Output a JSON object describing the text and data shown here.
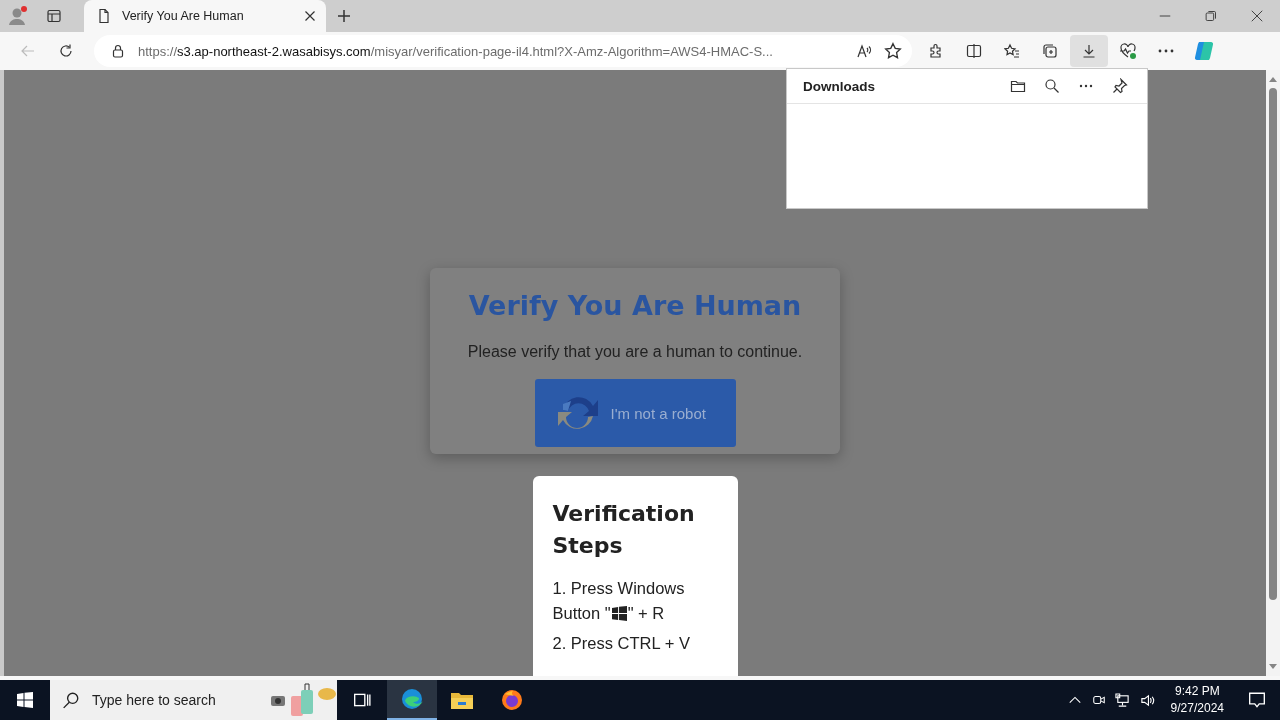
{
  "tabs": [
    {
      "title": "Verify You Are Human",
      "selected": true
    }
  ],
  "address": {
    "scheme": "https://",
    "host": "s3.ap-northeast-2.wasabisys.com",
    "path": "/misyar/verification-page-il4.html?X-Amz-Algorithm=AWS4-HMAC-S..."
  },
  "downloads_panel": {
    "title": "Downloads"
  },
  "verify_card": {
    "title": "Verify You Are Human",
    "message": "Please verify that you are a human to continue.",
    "button": "I'm not a robot"
  },
  "steps_card": {
    "title": "Verification Steps",
    "steps": [
      {
        "kind": "text",
        "text": "1. Press Windows"
      },
      {
        "kind": "key",
        "text": "Button \"",
        "after": "\" + R"
      },
      {
        "kind": "text",
        "text": "2. Press CTRL + V"
      }
    ]
  },
  "taskbar": {
    "search_placeholder": "Type here to search",
    "time": "9:42 PM",
    "date": "9/27/2024"
  }
}
